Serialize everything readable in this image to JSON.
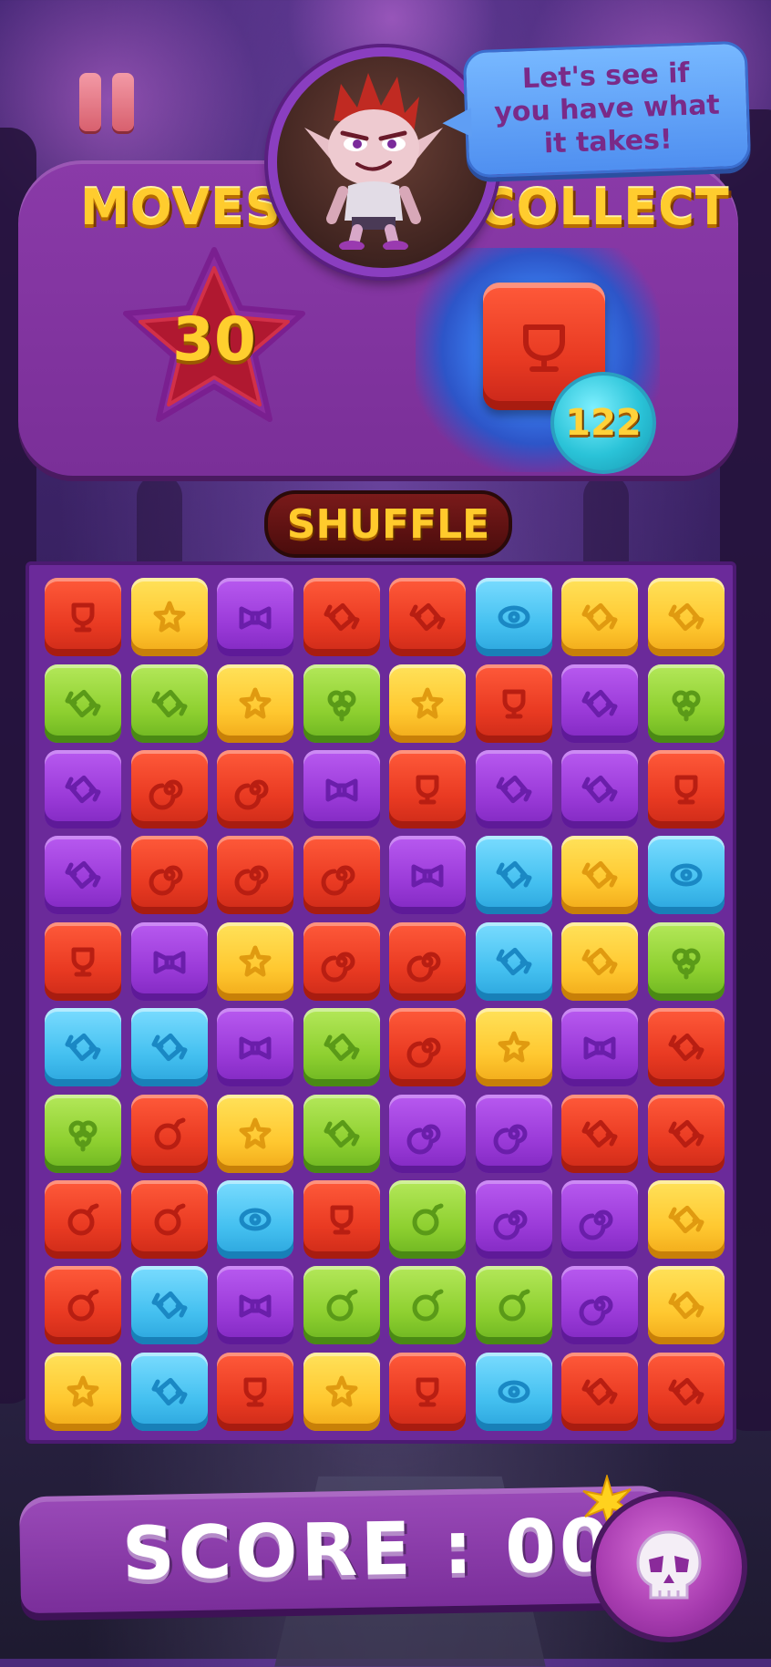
{
  "hud": {
    "pause_label": "",
    "moves_label": "MOVES",
    "moves_value": "30",
    "collect_label": "COLLECT",
    "collect_target": "red-trophy-tile",
    "collect_count": "122"
  },
  "speech_bubble": {
    "text": "Let's see if you have what it takes!"
  },
  "shuffle_label": "SHUFFLE",
  "score": {
    "label": "SCORE : 000"
  },
  "board": {
    "columns": 8,
    "rows": 10,
    "tiles": [
      [
        "red:trophy",
        "yellow:star",
        "purple:bow",
        "red:candy",
        "red:candy",
        "blue:eye",
        "yellow:candy",
        "yellow:candy"
      ],
      [
        "green:candy",
        "green:candy",
        "yellow:star",
        "green:clover",
        "yellow:star",
        "red:trophy",
        "purple:candy",
        "green:clover"
      ],
      [
        "purple:candy",
        "red:swirl",
        "red:swirl",
        "purple:bow",
        "red:trophy",
        "purple:candy",
        "purple:candy",
        "red:trophy"
      ],
      [
        "purple:candy",
        "red:swirl",
        "red:swirl",
        "red:swirl",
        "purple:bow",
        "blue:candy",
        "yellow:candy",
        "blue:eye"
      ],
      [
        "red:trophy",
        "purple:bow",
        "yellow:star",
        "red:swirl",
        "red:swirl",
        "blue:candy",
        "yellow:candy",
        "green:clover"
      ],
      [
        "blue:candy",
        "blue:candy",
        "purple:bow",
        "green:candy",
        "red:swirl",
        "yellow:star",
        "purple:bow",
        "red:candy"
      ],
      [
        "green:clover",
        "red:bomb",
        "yellow:star",
        "green:candy",
        "purple:swirl",
        "purple:swirl",
        "red:candy",
        "red:candy"
      ],
      [
        "red:bomb",
        "red:bomb",
        "blue:eye",
        "red:trophy",
        "green:bomb",
        "purple:swirl",
        "purple:swirl",
        "yellow:candy"
      ],
      [
        "red:bomb",
        "blue:candy",
        "purple:bow",
        "green:bomb",
        "green:bomb",
        "green:bomb",
        "purple:swirl",
        "yellow:candy"
      ],
      [
        "yellow:star",
        "blue:candy",
        "red:trophy",
        "yellow:star",
        "red:trophy",
        "blue:eye",
        "red:candy",
        "red:candy"
      ]
    ]
  },
  "icons": {
    "pause": "pause-icon",
    "skull": "skull-icon",
    "avatar": "goblin-character"
  },
  "colors": {
    "panel": "#8a3aa8",
    "title_gold": "#ffcc2e",
    "red_tile": "#e93a22",
    "yellow_tile": "#ffc830",
    "purple_tile": "#9a3ad8",
    "blue_tile": "#44c0f0",
    "green_tile": "#8ed030"
  }
}
